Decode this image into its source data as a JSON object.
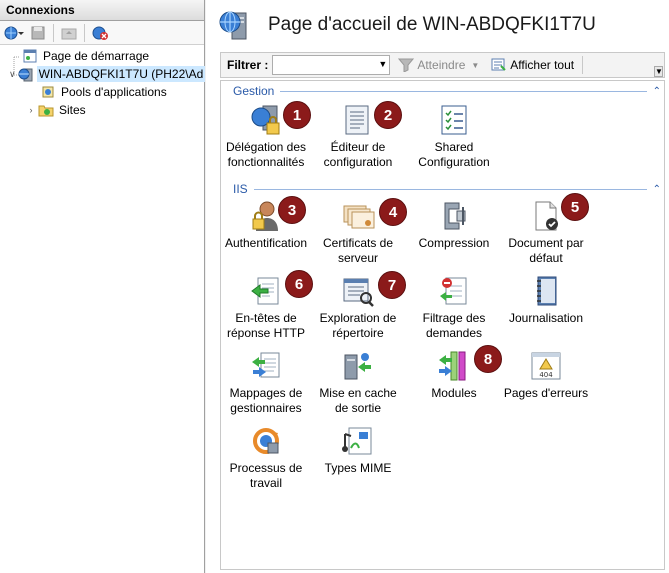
{
  "connections": {
    "title": "Connexions",
    "tree": [
      {
        "label": "Page de démarrage"
      },
      {
        "label": "WIN-ABDQFKI1T7U (PH22\\Ad"
      },
      {
        "label": "Pools d'applications"
      },
      {
        "label": "Sites"
      }
    ]
  },
  "main": {
    "title": "Page d'accueil de WIN-ABDQFKI1T7U",
    "filter": {
      "label": "Filtrer :",
      "value": "",
      "goto_label": "Atteindre",
      "show_all_label": "Afficher tout"
    },
    "groups": {
      "gestion": "Gestion",
      "iis": "IIS"
    },
    "features": {
      "delegation": "Délégation des fonctionnalités",
      "editeur": "Éditeur de configuration",
      "shared": "Shared Configuration",
      "auth": "Authentification",
      "certs": "Certificats de serveur",
      "compression": "Compression",
      "docdefaut": "Document par défaut",
      "entetes": "En-têtes de réponse HTTP",
      "exploration": "Exploration de répertoire",
      "filtrage": "Filtrage des demandes",
      "journal": "Journalisation",
      "mappages": "Mappages de gestionnaires",
      "cache": "Mise en cache de sortie",
      "modules": "Modules",
      "erreurs": "Pages d'erreurs",
      "processus": "Processus de travail",
      "mime": "Types MIME"
    },
    "badges": [
      "1",
      "2",
      "3",
      "4",
      "5",
      "6",
      "7",
      "8"
    ],
    "error_icon_text": "404"
  },
  "colors": {
    "badge": "#8b1a1a",
    "group_header": "#2a5aa8",
    "selection": "#cce8ff"
  }
}
